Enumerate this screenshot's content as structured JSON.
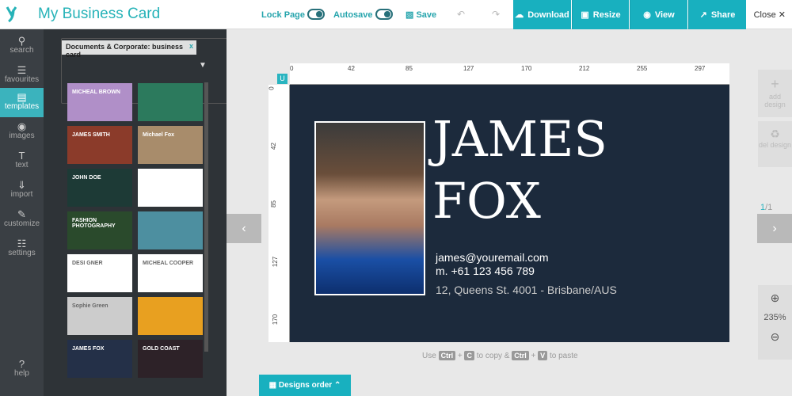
{
  "header": {
    "title": "My Business Card",
    "lock_label": "Lock Page",
    "autosave_label": "Autosave",
    "save_label": "Save",
    "download": "Download",
    "resize": "Resize",
    "view": "View",
    "share": "Share",
    "close": "Close"
  },
  "sidebar": {
    "items": [
      {
        "label": "search",
        "icon": "search-icon"
      },
      {
        "label": "favourites",
        "icon": "books-icon"
      },
      {
        "label": "templates",
        "icon": "template-icon"
      },
      {
        "label": "images",
        "icon": "camera-icon"
      },
      {
        "label": "text",
        "icon": "text-icon"
      },
      {
        "label": "import",
        "icon": "import-icon"
      },
      {
        "label": "customize",
        "icon": "brush-icon"
      },
      {
        "label": "settings",
        "icon": "sliders-icon"
      }
    ],
    "help": "help"
  },
  "panel": {
    "filter_tag": "Documents & Corporate: business card",
    "templates": [
      {
        "label": "MICHEAL BROWN",
        "bg": "#b08fc8"
      },
      {
        "label": "",
        "bg": "#2c7a5d"
      },
      {
        "label": "JAMES SMITH",
        "bg": "#8b3b2a"
      },
      {
        "label": "Michael Fox",
        "bg": "#a88c6b"
      },
      {
        "label": "JOHN DOE",
        "bg": "#1d3a36"
      },
      {
        "label": "",
        "bg": "#ffffff"
      },
      {
        "label": "FASHION PHOTOGRAPHY",
        "bg": "#2a4a2c"
      },
      {
        "label": "",
        "bg": "#4d8fa0"
      },
      {
        "label": "DESI GNER",
        "bg": "#ffffff"
      },
      {
        "label": "MICHEAL COOPER",
        "bg": "#ffffff"
      },
      {
        "label": "Sophie Green",
        "bg": "#cccccc"
      },
      {
        "label": "",
        "bg": "#e8a020"
      },
      {
        "label": "JAMES FOX",
        "bg": "#243048"
      },
      {
        "label": "GOLD COAST",
        "bg": "#2d2228"
      }
    ]
  },
  "rulers": {
    "h": [
      "0",
      "42",
      "85",
      "127",
      "170",
      "212",
      "255",
      "297"
    ],
    "v": [
      "0",
      "42",
      "85",
      "127",
      "170"
    ]
  },
  "card": {
    "first_name": "JAMES",
    "last_name": "FOX",
    "email": "james@youremail.com",
    "phone": "m. +61 123 456 789",
    "address": "12, Queens St. 4001 - Brisbane/AUS"
  },
  "right": {
    "add": "add design",
    "del": "del design",
    "page": "1",
    "total": "/1",
    "zoom": "235%"
  },
  "hint": {
    "use": "Use",
    "ctrl1": "Ctrl",
    "c": "C",
    "copy": "to copy &",
    "ctrl2": "Ctrl",
    "v": "V",
    "paste": "to paste"
  },
  "designs_order": "Designs order"
}
